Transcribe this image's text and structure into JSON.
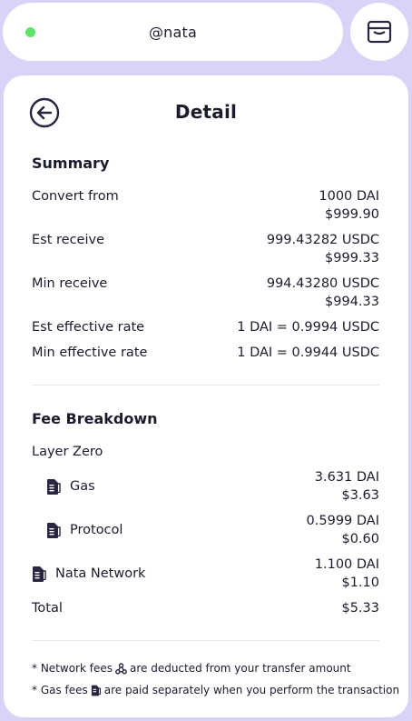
{
  "header": {
    "username": "@nata"
  },
  "detail": {
    "title": "Detail",
    "summary": {
      "heading": "Summary",
      "rows": [
        {
          "label": "Convert from",
          "value1": "1000 DAI",
          "value2": "$999.90"
        },
        {
          "label": "Est receive",
          "value1": "999.43282 USDC",
          "value2": "$999.33"
        },
        {
          "label": "Min receive",
          "value1": "994.43280 USDC",
          "value2": "$994.33"
        },
        {
          "label": "Est effective rate",
          "value1": "1 DAI = 0.9994 USDC"
        },
        {
          "label": "Min effective rate",
          "value1": "1 DAI = 0.9944 USDC"
        }
      ]
    },
    "fees": {
      "heading": "Fee Breakdown",
      "group_label": "Layer Zero",
      "gas": {
        "label": "Gas",
        "value1": "3.631 DAI",
        "value2": "$3.63"
      },
      "protocol": {
        "label": "Protocol",
        "value1": "0.5999 DAI",
        "value2": "$0.60"
      },
      "network": {
        "label": "Nata Network",
        "value1": "1.100 DAI",
        "value2": "$1.10"
      },
      "total": {
        "label": "Total",
        "value": "$5.33"
      }
    },
    "notes": {
      "network_pre": "* Network fees",
      "network_post": "are deducted from your transfer amount",
      "gas_pre": "* Gas fees",
      "gas_post": "are paid separately when you perform the transaction"
    }
  },
  "colors": {
    "background": "#d8d4f8",
    "online": "#5fe36a",
    "text": "#1b1b2e"
  }
}
